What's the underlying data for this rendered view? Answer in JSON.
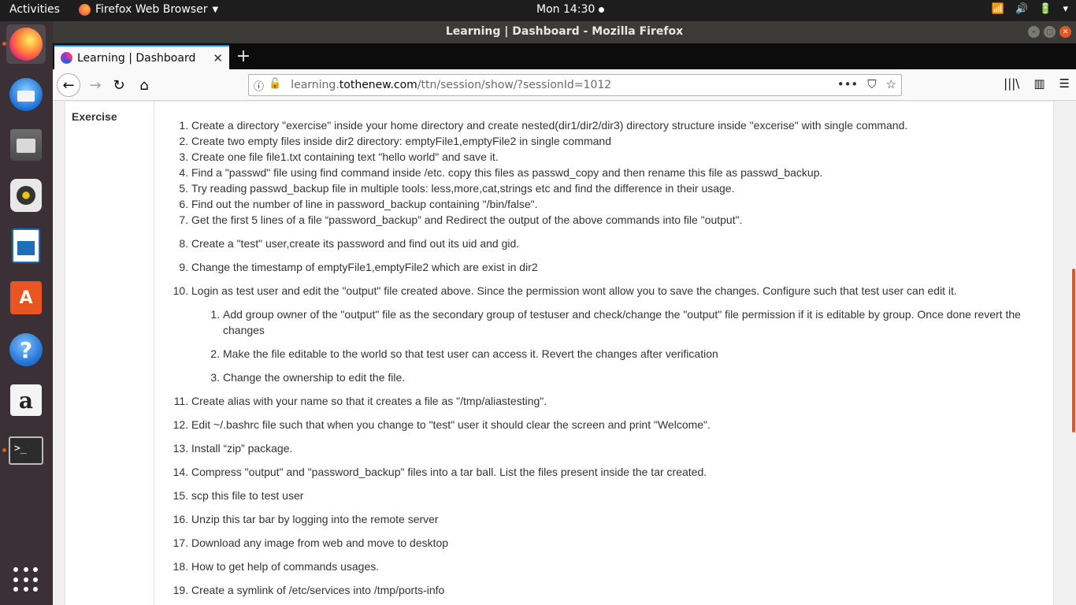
{
  "topbar": {
    "activities": "Activities",
    "app_menu": "Firefox Web Browser",
    "clock": "Mon 14:30"
  },
  "window": {
    "title": "Learning | Dashboard - Mozilla Firefox"
  },
  "tab": {
    "title": "Learning | Dashboard"
  },
  "url": {
    "prefix": "learning.",
    "host": "tothenew.com",
    "path": "/ttn/session/show/?sessionId=1012"
  },
  "page": {
    "section_label": "Exercise",
    "exercises": [
      "Create a directory \"exercise\" inside your home directory and create nested(dir1/dir2/dir3) directory structure inside \"excerise\" with single command.",
      "Create two empty files inside dir2 directory: emptyFile1,emptyFile2 in single command",
      "Create one file file1.txt containing text \"hello world\" and save it.",
      "Find a \"passwd\" file using find command inside /etc. copy this files as passwd_copy and then rename this file as passwd_backup.",
      "Try reading passwd_backup file in multiple tools: less,more,cat,strings etc and find the difference in their usage.",
      "Find out the number of line in password_backup containing \"/bin/false\".",
      "Get the first 5 lines of a file “password_backup” and  Redirect the output of the above commands into file \"output\".",
      "Create a \"test\" user,create its password and find out its uid and gid.",
      "Change the timestamp of  emptyFile1,emptyFile2 which are exist in dir2",
      "Login as test user and edit the \"output\" file created above. Since the permission wont allow you to save the changes. Configure such that test user can edit it.",
      "Create alias with your name so that it creates a file as \"/tmp/aliastesting\".",
      "Edit ~/.bashrc file such that when you change to \"test\" user it should clear the screen and print \"Welcome\".",
      "Install “zip” package.",
      "Compress \"output\" and \"password_backup\" files into a tar ball. List the files present inside the tar created.",
      "scp this file to test user",
      "Unzip this tar bar by logging into the remote server",
      "Download any image from web and move to desktop",
      "How to get help of commands usages.",
      "Create a symlink of /etc/services into /tmp/ports-info"
    ],
    "sub_exercises": [
      "Add group owner of the \"output\" file as the secondary group of testuser and check/change the \"output\" file permission if it is editable by group. Once done revert the changes",
      "Make the file editable to the world so that test user can access it. Revert the changes after verification",
      "Change the ownership to edit the file."
    ]
  },
  "colors": {
    "accent": "#e95420",
    "tab_highlight": "#0a84ff"
  }
}
